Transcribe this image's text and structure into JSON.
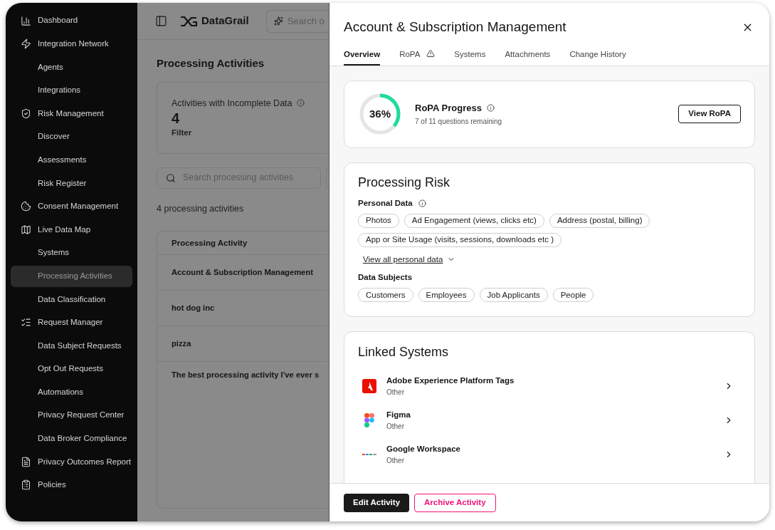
{
  "sidebar": {
    "items": [
      {
        "label": "Dashboard",
        "kind": "section",
        "selected": false
      },
      {
        "label": "Integration Network",
        "kind": "section",
        "selected": false
      },
      {
        "label": "Agents",
        "kind": "sub",
        "selected": false
      },
      {
        "label": "Integrations",
        "kind": "sub",
        "selected": false
      },
      {
        "label": "Risk Management",
        "kind": "section",
        "selected": false
      },
      {
        "label": "Discover",
        "kind": "sub",
        "selected": false
      },
      {
        "label": "Assessments",
        "kind": "sub",
        "selected": false
      },
      {
        "label": "Risk Register",
        "kind": "sub",
        "selected": false
      },
      {
        "label": "Consent Management",
        "kind": "section",
        "selected": false
      },
      {
        "label": "Live Data Map",
        "kind": "section",
        "selected": false
      },
      {
        "label": "Systems",
        "kind": "sub",
        "selected": false
      },
      {
        "label": "Processing Activities",
        "kind": "sub",
        "selected": true
      },
      {
        "label": "Data Classification",
        "kind": "sub",
        "selected": false
      },
      {
        "label": "Request Manager",
        "kind": "section",
        "selected": false
      },
      {
        "label": "Data Subject Requests",
        "kind": "sub",
        "selected": false
      },
      {
        "label": "Opt Out Requests",
        "kind": "sub",
        "selected": false
      },
      {
        "label": "Automations",
        "kind": "sub",
        "selected": false
      },
      {
        "label": "Privacy Request Center",
        "kind": "sub",
        "selected": false
      },
      {
        "label": "Data Broker Compliance",
        "kind": "sub",
        "selected": false
      },
      {
        "label": "Privacy Outcomes Report",
        "kind": "section",
        "selected": false
      },
      {
        "label": "Policies",
        "kind": "section",
        "selected": false
      }
    ]
  },
  "header": {
    "logo": "DataGrail",
    "search": {
      "placeholder": "Search o"
    }
  },
  "main": {
    "title": "Processing Activities",
    "stat": {
      "label": "Activities with Incomplete Data",
      "value": "4",
      "link": "Filter"
    },
    "search": {
      "placeholder": "Search processing activities"
    },
    "count": "4 processing activities",
    "table": {
      "columns": [
        "Processing Activity"
      ],
      "rows": [
        [
          "Account & Subscription Management"
        ],
        [
          "hot dog inc"
        ],
        [
          "pizza"
        ],
        [
          "The best processing activity I've ever s"
        ]
      ]
    }
  },
  "panel": {
    "title": "Account & Subscription Management",
    "tabs": [
      {
        "label": "Overview",
        "selected": true,
        "warning": false
      },
      {
        "label": "RoPA",
        "selected": false,
        "warning": true
      },
      {
        "label": "Systems",
        "selected": false,
        "warning": false
      },
      {
        "label": "Attachments",
        "selected": false,
        "warning": false
      },
      {
        "label": "Change History",
        "selected": false,
        "warning": false
      }
    ],
    "progress": {
      "level": 0.36,
      "percent": "36%",
      "title": "RoPA Progress",
      "subtitle": "7 of 11 questions remaining",
      "button": "View RoPA"
    },
    "risk": {
      "title": "Processing Risk",
      "personal_data_label": "Personal Data",
      "personal_data": [
        "Photos",
        "Ad Engagement (views, clicks etc)",
        "Address (postal, billing)",
        "App or Site Usage (visits, sessions, downloads etc )"
      ],
      "view_all": "View all personal data",
      "subjects_label": "Data Subjects",
      "subjects": [
        "Customers",
        "Employees",
        "Job Applicants",
        "People"
      ]
    },
    "linked_systems": {
      "title": "Linked Systems",
      "systems": [
        {
          "name": "Adobe Experience Platform Tags",
          "category": "Other"
        },
        {
          "name": "Figma",
          "category": "Other"
        },
        {
          "name": "Google Workspace",
          "category": "Other"
        }
      ]
    },
    "footer": [
      {
        "label": "Edit Activity",
        "kind": "primary"
      },
      {
        "label": "Archive Activity",
        "kind": "danger"
      }
    ]
  }
}
